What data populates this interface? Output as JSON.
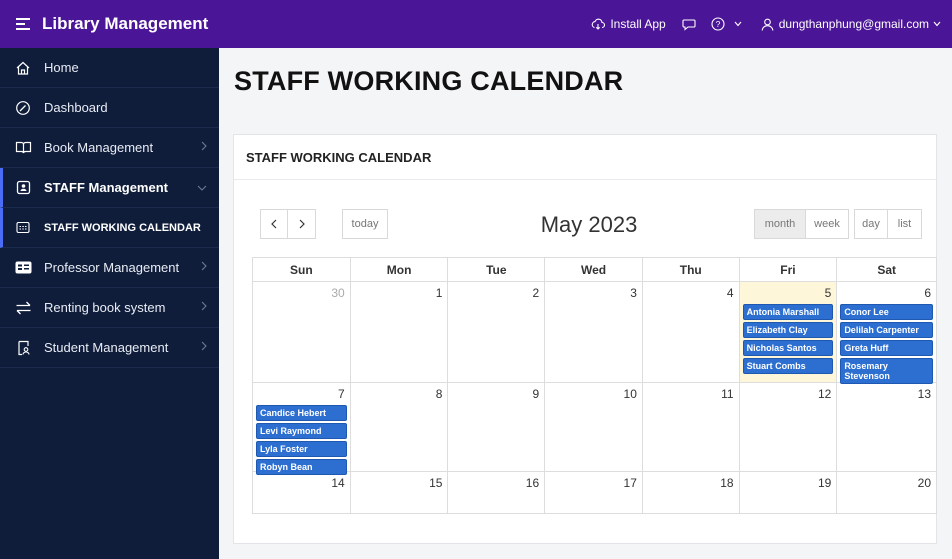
{
  "app": {
    "title": "Library Management"
  },
  "topbar": {
    "install": "Install App",
    "user": "dungthanphung@gmail.com"
  },
  "sidebar": {
    "items": [
      {
        "label": "Home",
        "icon": "home-icon"
      },
      {
        "label": "Dashboard",
        "icon": "dashboard-icon"
      },
      {
        "label": "Book Management",
        "icon": "book-icon"
      },
      {
        "label": "STAFF Management",
        "icon": "staff-icon"
      },
      {
        "label": "STAFF WORKING CALENDAR",
        "icon": "calendar-icon"
      },
      {
        "label": "Professor Management",
        "icon": "id-card-icon"
      },
      {
        "label": "Renting book system",
        "icon": "swap-icon"
      },
      {
        "label": "Student Management",
        "icon": "student-icon"
      }
    ]
  },
  "page": {
    "title": "STAFF WORKING CALENDAR"
  },
  "card": {
    "title": "STAFF WORKING CALENDAR"
  },
  "calendar": {
    "title": "May 2023",
    "today_label": "today",
    "views": [
      "month",
      "week",
      "day",
      "list"
    ],
    "active_view": "month",
    "dow": [
      "Sun",
      "Mon",
      "Tue",
      "Wed",
      "Thu",
      "Fri",
      "Sat"
    ],
    "weeks": [
      [
        {
          "num": "30",
          "other": true,
          "events": []
        },
        {
          "num": "1",
          "events": []
        },
        {
          "num": "2",
          "events": []
        },
        {
          "num": "3",
          "events": []
        },
        {
          "num": "4",
          "events": []
        },
        {
          "num": "5",
          "today": true,
          "events": [
            "Antonia Marshall",
            "Elizabeth Clay",
            "Nicholas Santos",
            "Stuart Combs"
          ]
        },
        {
          "num": "6",
          "events": [
            "Conor Lee",
            "Delilah Carpenter",
            "Greta Huff",
            "Rosemary Stevenson"
          ]
        }
      ],
      [
        {
          "num": "7",
          "events": [
            "Candice Hebert",
            "Levi Raymond",
            "Lyla Foster",
            "Robyn Bean"
          ]
        },
        {
          "num": "8",
          "events": []
        },
        {
          "num": "9",
          "events": []
        },
        {
          "num": "10",
          "events": []
        },
        {
          "num": "11",
          "events": []
        },
        {
          "num": "12",
          "events": []
        },
        {
          "num": "13",
          "events": []
        }
      ],
      [
        {
          "num": "14",
          "events": []
        },
        {
          "num": "15",
          "events": []
        },
        {
          "num": "16",
          "events": []
        },
        {
          "num": "17",
          "events": []
        },
        {
          "num": "18",
          "events": []
        },
        {
          "num": "19",
          "events": []
        },
        {
          "num": "20",
          "events": []
        }
      ]
    ]
  },
  "colors": {
    "topbar": "#4a1596",
    "sidebar": "#0f1d3a",
    "event": "#2d6fd0",
    "today_bg": "#fdf6d9"
  }
}
